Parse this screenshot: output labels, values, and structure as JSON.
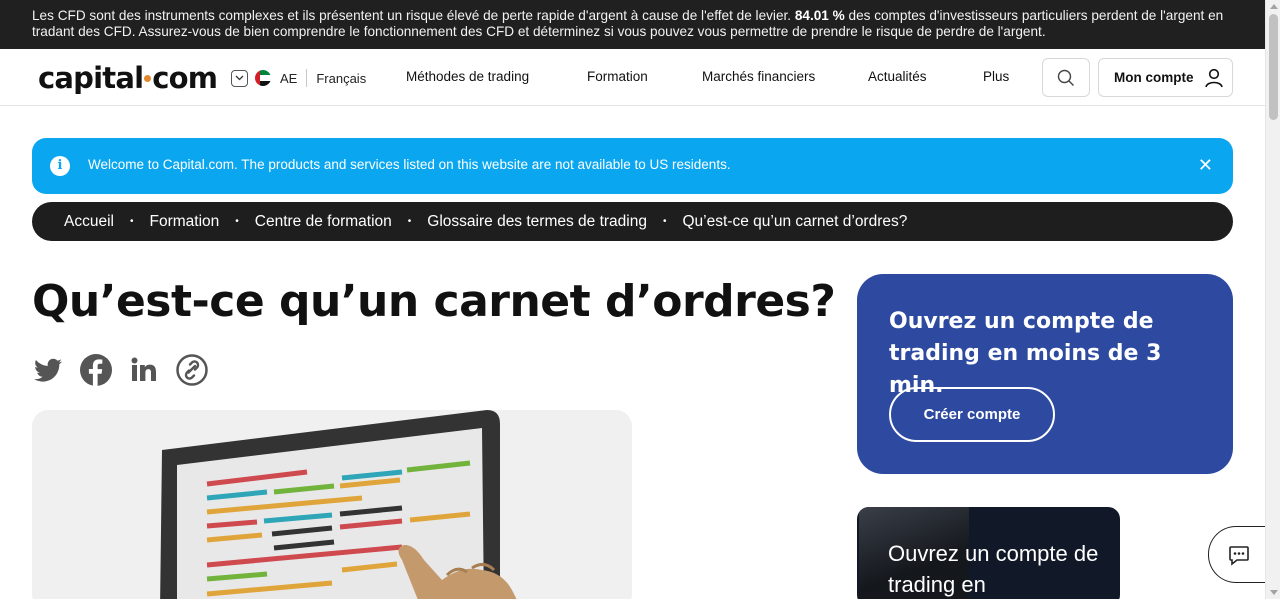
{
  "risk_banner": {
    "text_before": "Les CFD sont des instruments complexes et ils présentent un risque élevé de perte rapide d'argent à cause de l'effet de levier. ",
    "percent": "84.01 %",
    "text_after": " des comptes d'investisseurs particuliers perdent de l'argent en tradant des CFD. Assurez-vous de bien comprendre le fonctionnement des CFD et déterminez si vous pouvez vous permettre de prendre le risque de perdre de l'argent."
  },
  "header": {
    "logo_left": "capital",
    "logo_right": "com",
    "region": "AE",
    "language": "Français",
    "nav": [
      "Méthodes de trading",
      "Formation",
      "Marchés financiers",
      "Actualités",
      "Plus"
    ],
    "account_label": "Mon compte"
  },
  "notice": {
    "text": "Welcome to Capital.com. The products and services listed on this website are not available to US residents."
  },
  "breadcrumb": [
    "Accueil",
    "Formation",
    "Centre de formation",
    "Glossaire des termes de trading",
    "Qu’est-ce qu’un carnet d’ordres?"
  ],
  "article": {
    "title": "Qu’est-ce qu’un carnet d’ordres?",
    "share_icons": [
      "twitter-icon",
      "facebook-icon",
      "linkedin-icon",
      "copy-link-icon"
    ]
  },
  "cta": {
    "heading": "Ouvrez un compte de trading en moins de 3 min.",
    "button": "Créer compte"
  },
  "promo": {
    "text": "Ouvrez un compte de trading en"
  },
  "colors": {
    "risk_bg": "#202020",
    "notice_bg": "#0aa7f0",
    "breadcrumb_bg": "#1e1e1e",
    "cta_bg": "#2d4aa0",
    "logo_dot": "#e3872d"
  }
}
